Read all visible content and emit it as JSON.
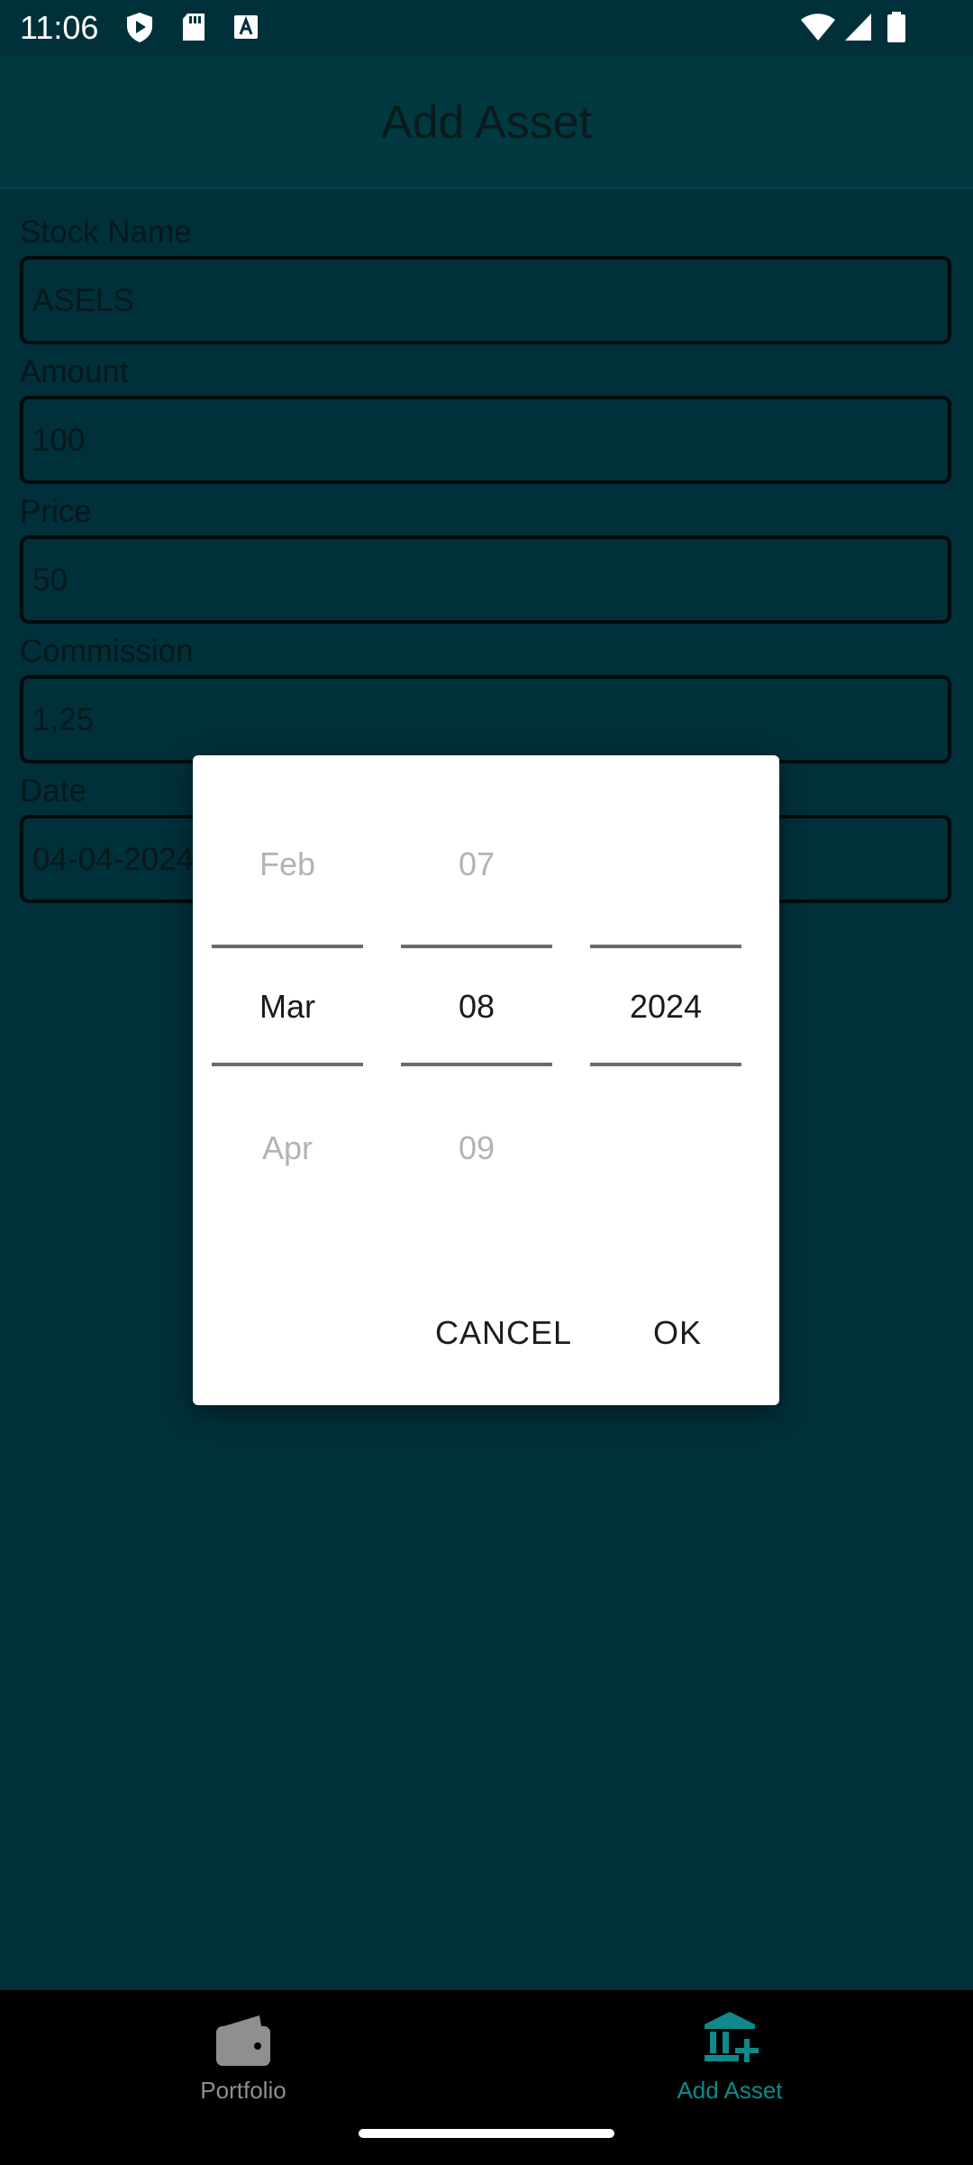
{
  "status_bar": {
    "time": "11:06",
    "left_icons": [
      "shield-play-icon",
      "sd-card-icon",
      "font-a-icon"
    ],
    "right_icons": [
      "wifi-icon",
      "signal-icon",
      "battery-icon"
    ]
  },
  "app_bar": {
    "title": "Add Asset"
  },
  "form": {
    "stock_name": {
      "label": "Stock Name",
      "value": "ASELS"
    },
    "amount": {
      "label": "Amount",
      "value": "100"
    },
    "price": {
      "label": "Price",
      "value": "50"
    },
    "commission": {
      "label": "Commission",
      "value": "1,25"
    },
    "date": {
      "label": "Date",
      "value": "04-04-2024"
    }
  },
  "date_picker": {
    "month": {
      "prev": "Feb",
      "current": "Mar",
      "next": "Apr"
    },
    "day": {
      "prev": "07",
      "current": "08",
      "next": "09"
    },
    "year": {
      "prev": "",
      "current": "2024",
      "next": ""
    },
    "cancel_label": "CANCEL",
    "ok_label": "OK"
  },
  "bottom_nav": {
    "items": [
      {
        "label": "Portfolio",
        "icon": "wallet-icon",
        "active": false
      },
      {
        "label": "Add Asset",
        "icon": "bank-add-icon",
        "active": true
      }
    ]
  },
  "colors": {
    "background": "#00303a",
    "dialog": "#ffffff",
    "active_nav": "#0e8a8a",
    "inactive_nav": "#8f8f8f"
  }
}
